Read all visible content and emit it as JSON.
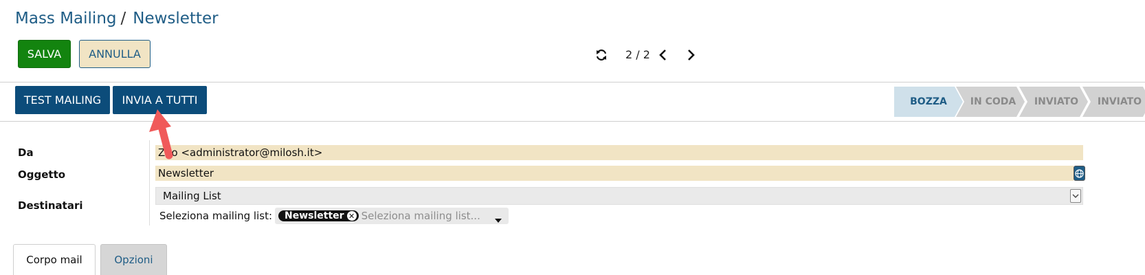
{
  "breadcrumb": {
    "parent": "Mass Mailing",
    "separator": "/",
    "current": "Newsletter"
  },
  "actions": {
    "save_label": "SALVA",
    "cancel_label": "ANNULLA"
  },
  "pager": {
    "value": "2 / 2"
  },
  "status_bar": {
    "test_label": "TEST MAILING",
    "send_all_label": "INVIA A TUTTI",
    "stages": [
      "BOZZA",
      "IN CODA",
      "INVIATO",
      "INVIATO"
    ],
    "active_stage": "BOZZA"
  },
  "form": {
    "from_label": "Da",
    "from_value": "Zeo <administrator@milosh.it>",
    "subject_label": "Oggetto",
    "subject_value": "Newsletter",
    "recipients_label": "Destinatari",
    "recipients_model": "Mailing List",
    "mailing_list_label": "Seleziona mailing list:",
    "mailing_list_tags": [
      "Newsletter"
    ],
    "mailing_list_placeholder": "Seleziona mailing list..."
  },
  "tabs": [
    {
      "label": "Corpo mail",
      "active": true
    },
    {
      "label": "Opzioni",
      "active": false
    }
  ],
  "colors": {
    "primary": "#0c4c7a",
    "save": "#13840f",
    "cancel_bg": "#f1e4c4",
    "link": "#1f5d86",
    "annotation_arrow": "#f05a5a"
  },
  "icons": [
    "refresh-icon",
    "chevron-left-icon",
    "chevron-right-icon",
    "translate-icon",
    "dropdown-caret-icon",
    "remove-tag-icon"
  ]
}
